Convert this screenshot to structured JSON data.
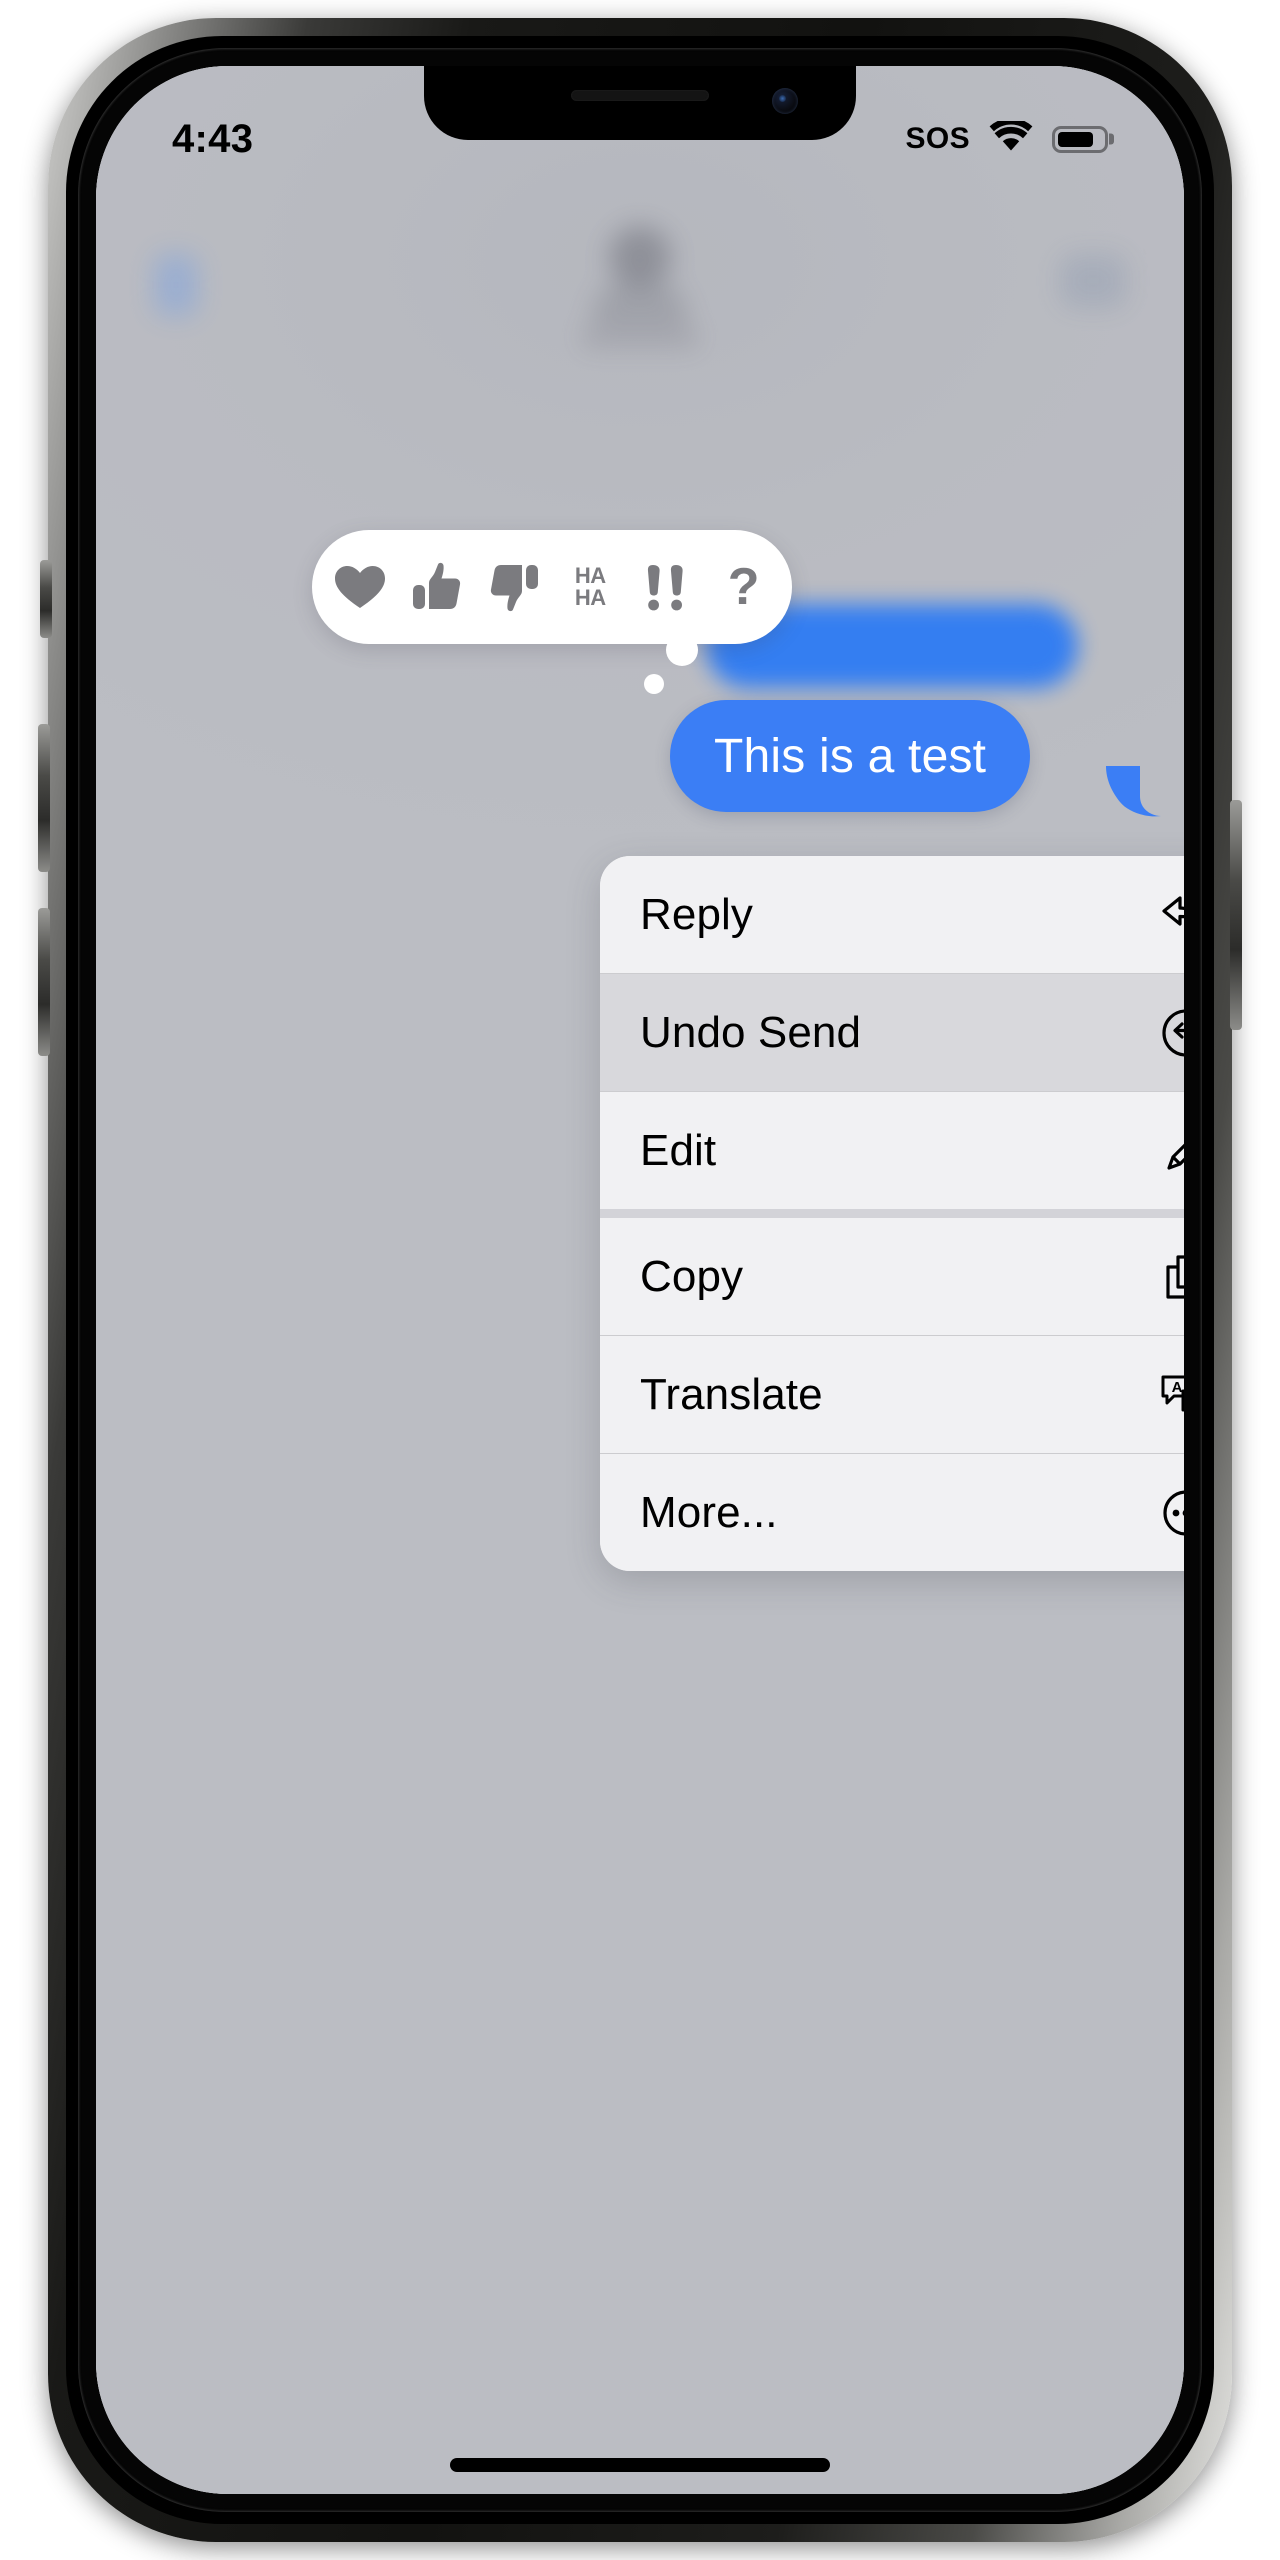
{
  "status_bar": {
    "time": "4:43",
    "sos_label": "SOS",
    "wifi_icon": "wifi-icon",
    "battery_icon": "battery-icon",
    "battery_level_pct": 72
  },
  "message": {
    "text": "This is a test",
    "bubble_color": "#3b7ef5",
    "text_color": "#ffffff",
    "alignment": "outgoing"
  },
  "reactions": {
    "items": [
      {
        "name": "heart-reaction",
        "icon": "heart-icon",
        "label": "Love"
      },
      {
        "name": "thumbs-up-reaction",
        "icon": "thumbs-up-icon",
        "label": "Like"
      },
      {
        "name": "thumbs-down-reaction",
        "icon": "thumbs-down-icon",
        "label": "Dislike"
      },
      {
        "name": "haha-reaction",
        "icon": "haha-icon",
        "label": "HA HA",
        "line1": "HA",
        "line2": "HA"
      },
      {
        "name": "exclamation-reaction",
        "icon": "double-exclamation-icon",
        "label": "!!"
      },
      {
        "name": "question-reaction",
        "icon": "question-mark-icon",
        "label": "?"
      }
    ],
    "bar_color": "#ffffff",
    "glyph_color": "#7b7b7f"
  },
  "context_menu": {
    "background": "#f1f1f3",
    "highlight_color": "#d8d8dc",
    "items": [
      {
        "label": "Reply",
        "icon": "reply-arrow-icon",
        "highlighted": false
      },
      {
        "label": "Undo Send",
        "icon": "undo-circle-icon",
        "highlighted": true
      },
      {
        "label": "Edit",
        "icon": "pencil-icon",
        "highlighted": false
      },
      {
        "label": "Copy",
        "icon": "copy-documents-icon",
        "highlighted": false
      },
      {
        "label": "Translate",
        "icon": "translate-icon",
        "highlighted": false
      },
      {
        "label": "More...",
        "icon": "ellipsis-circle-icon",
        "highlighted": false
      }
    ]
  },
  "home_indicator": {
    "name": "home-indicator"
  }
}
